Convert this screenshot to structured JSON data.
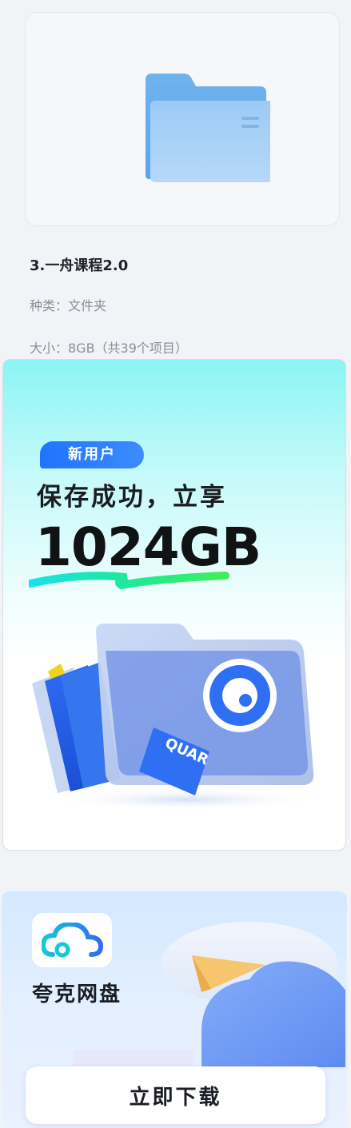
{
  "file": {
    "icon": "folder-icon",
    "name": "3.一舟课程2.0",
    "type_label": "种类：文件夹",
    "size_label": "大小：8GB（共39个项目）"
  },
  "promo": {
    "badge": "新用户",
    "headline": "保存成功，立享",
    "big_number": "1024GB",
    "illustration_text": "QUAR",
    "colors": {
      "accent": "#1f74ff",
      "top_gradient": "#8cf4f4"
    }
  },
  "app": {
    "name": "夸克网盘",
    "logo_icon": "cloud-icon",
    "download_label": "立即下载"
  }
}
